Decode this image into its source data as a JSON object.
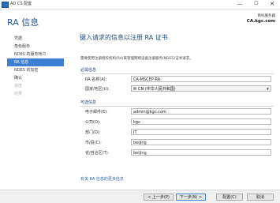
{
  "window": {
    "title": "AD CS 配置",
    "minimize": "—",
    "maximize": "☐",
    "close": "✕"
  },
  "header": {
    "title": "RA 信息",
    "dest_label": "目标服务器",
    "dest_value": "CA.kgc.com"
  },
  "sidebar": {
    "items": [
      {
        "label": "凭据",
        "state": "normal"
      },
      {
        "label": "角色服务",
        "state": "normal"
      },
      {
        "label": "NDES 的服务帐户",
        "state": "normal"
      },
      {
        "label": "RA 信息",
        "state": "active"
      },
      {
        "label": "NDES 的加密",
        "state": "normal"
      },
      {
        "label": "确认",
        "state": "normal"
      },
      {
        "label": "进度",
        "state": "disabled"
      },
      {
        "label": "结果",
        "state": "disabled"
      }
    ]
  },
  "main": {
    "heading": "键入请求的信息以注册 RA 证书",
    "intro": "需要使用注册授权机构(RA)来管理网络设备注册服务(NDES)证书请求。",
    "required_section": "必需信息",
    "optional_section": "可选信息",
    "ra_name_label": "RA 名称(A):",
    "ra_name_value": "CA-MSCEP-RA",
    "country_label": "国家/地区(U):",
    "country_value": "CN (中华人民共和国)",
    "email_label": "电子邮件(E):",
    "email_value": "admin@kgc.com",
    "company_label": "公司(O):",
    "company_value": "kgc",
    "department_label": "部门(D):",
    "department_value": "IT",
    "city_label": "市/县(C):",
    "city_value": "beijing",
    "state_label": "省/自治区(T):",
    "state_value": "beijing",
    "more_link": "有关 RA 信息的更多信息"
  },
  "footer": {
    "prev": "< 上一步(P)",
    "next": "下一步(N) >",
    "configure": "配置(C)",
    "cancel": "取消"
  }
}
